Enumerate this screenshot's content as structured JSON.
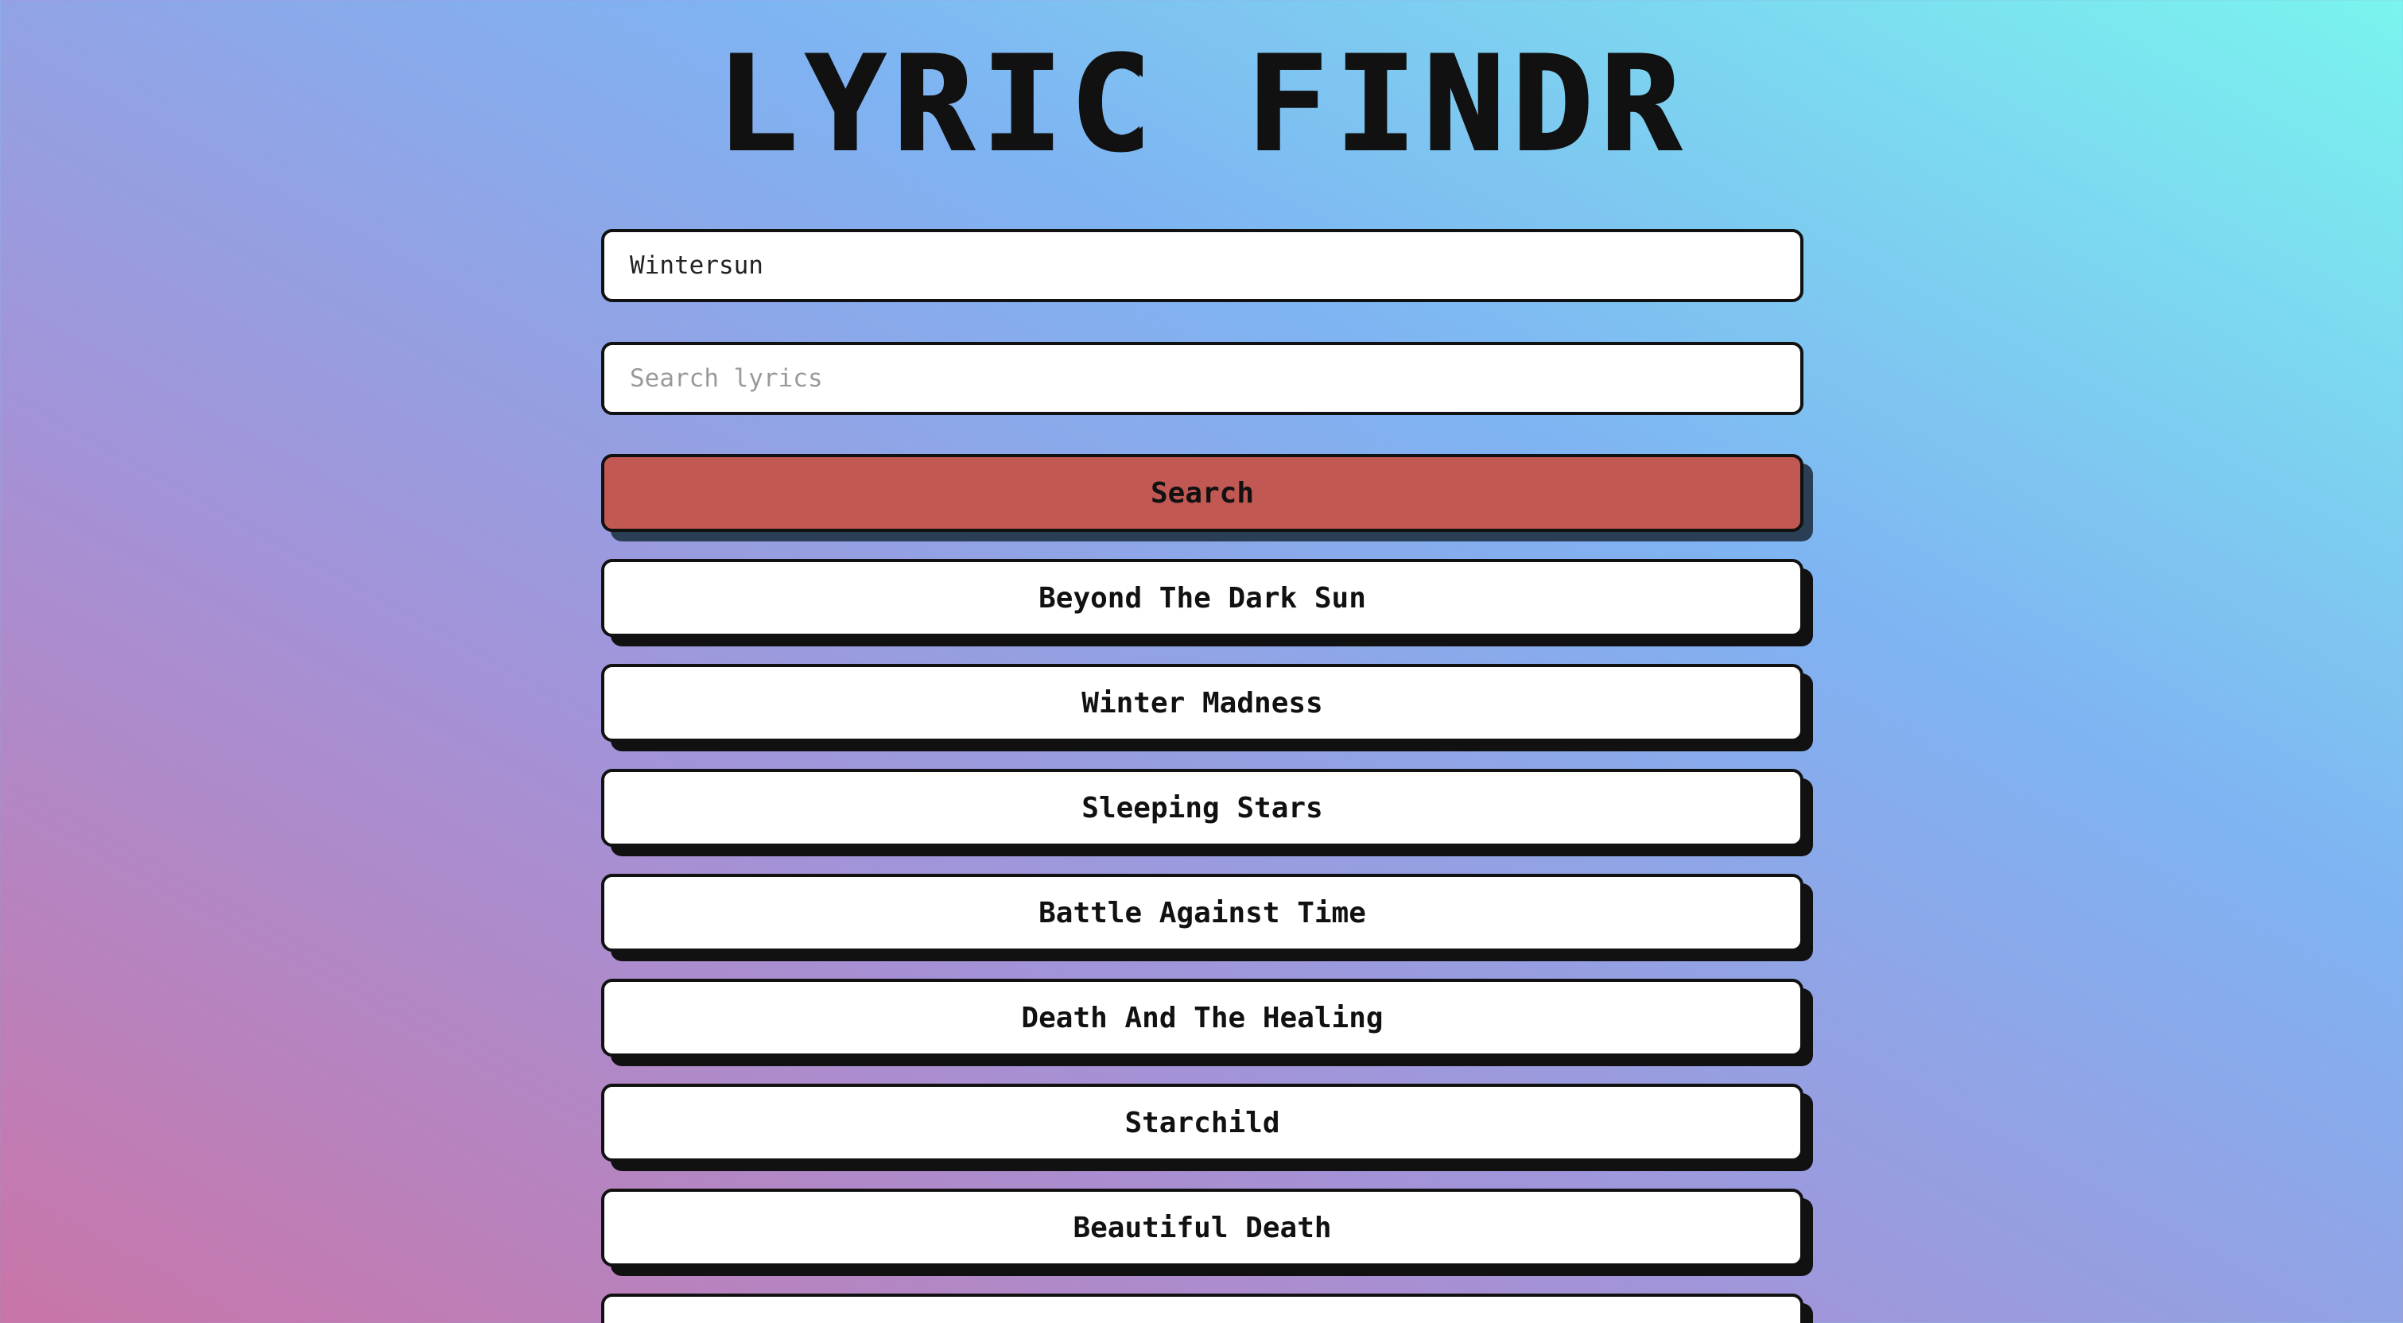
{
  "app": {
    "title": "LYRIC FINDR"
  },
  "form": {
    "artist_value": "Wintersun",
    "lyrics_placeholder": "Search lyrics",
    "search_label": "Search"
  },
  "results": [
    "Beyond The Dark Sun",
    "Winter Madness",
    "Sleeping Stars",
    "Battle Against Time",
    "Death And The Healing",
    "Starchild",
    "Beautiful Death",
    ""
  ],
  "colors": {
    "search_button": "#c15853",
    "button_shadow": "#111111",
    "search_shadow": "#2a3e55"
  }
}
